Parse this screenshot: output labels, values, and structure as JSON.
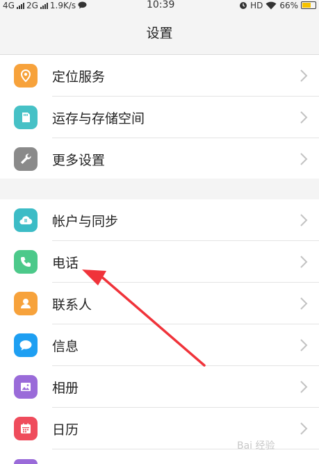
{
  "status_bar": {
    "net1": "4G",
    "net2": "2G",
    "speed": "1.9K/s",
    "time": "10:39",
    "hd": "HD",
    "battery": "66%",
    "battery_level": 0.66
  },
  "header": {
    "title": "设置"
  },
  "group1": [
    {
      "label": "定位服务",
      "icon": "location-icon",
      "color": "#f7a23b"
    },
    {
      "label": "运存与存储空间",
      "icon": "storage-icon",
      "color": "#46c1c6"
    },
    {
      "label": "更多设置",
      "icon": "wrench-icon",
      "color": "#8a8a8a"
    }
  ],
  "group2": [
    {
      "label": "帐户与同步",
      "icon": "cloud-sync-icon",
      "color": "#3cbcc6"
    },
    {
      "label": "电话",
      "icon": "phone-icon",
      "color": "#4cc98a"
    },
    {
      "label": "联系人",
      "icon": "contact-icon",
      "color": "#f7a23b"
    },
    {
      "label": "信息",
      "icon": "message-icon",
      "color": "#1e9ff2"
    },
    {
      "label": "相册",
      "icon": "gallery-icon",
      "color": "#9a6bd9"
    },
    {
      "label": "日历",
      "icon": "calendar-icon",
      "color": "#ef4c5c"
    }
  ],
  "annotation": {
    "arrow_color": "#f0333a"
  },
  "watermark": {
    "text": "Bai 经验"
  }
}
